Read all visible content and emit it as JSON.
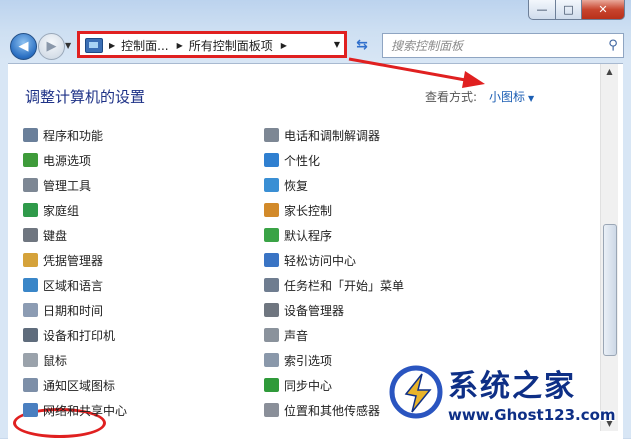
{
  "window": {
    "minimize_glyph": "—",
    "maximize_glyph": "□",
    "close_glyph": "✕"
  },
  "address": {
    "crumbs": [
      "控制面...",
      "所有控制面板项"
    ]
  },
  "search": {
    "placeholder": "搜索控制面板"
  },
  "header": {
    "title": "调整计算机的设置",
    "view_label": "查看方式:",
    "view_value": "小图标"
  },
  "items_left": [
    {
      "label": "程序和功能",
      "icon": "programs-icon",
      "color": "#6a7f9a"
    },
    {
      "label": "电源选项",
      "icon": "power-icon",
      "color": "#3e9b3a"
    },
    {
      "label": "管理工具",
      "icon": "admin-tools-icon",
      "color": "#7d8794"
    },
    {
      "label": "家庭组",
      "icon": "homegroup-icon",
      "color": "#2f9a4a"
    },
    {
      "label": "键盘",
      "icon": "keyboard-icon",
      "color": "#6f7680"
    },
    {
      "label": "凭据管理器",
      "icon": "credential-icon",
      "color": "#d5a23a"
    },
    {
      "label": "区域和语言",
      "icon": "region-icon",
      "color": "#3a86c8"
    },
    {
      "label": "日期和时间",
      "icon": "clock-icon",
      "color": "#8c9cb3"
    },
    {
      "label": "设备和打印机",
      "icon": "printer-icon",
      "color": "#5f6c7c"
    },
    {
      "label": "鼠标",
      "icon": "mouse-icon",
      "color": "#9aa2ab"
    },
    {
      "label": "通知区域图标",
      "icon": "notification-icon",
      "color": "#7d8fa8"
    },
    {
      "label": "网络和共享中心",
      "icon": "network-icon",
      "color": "#4a7fc0"
    }
  ],
  "items_right": [
    {
      "label": "电话和调制解调器",
      "icon": "phone-icon",
      "color": "#7d8794"
    },
    {
      "label": "个性化",
      "icon": "personalize-icon",
      "color": "#2f7fd0"
    },
    {
      "label": "恢复",
      "icon": "recovery-icon",
      "color": "#3a8fd4"
    },
    {
      "label": "家长控制",
      "icon": "parental-icon",
      "color": "#d28a2a"
    },
    {
      "label": "默认程序",
      "icon": "default-programs-icon",
      "color": "#3aa346"
    },
    {
      "label": "轻松访问中心",
      "icon": "accessibility-icon",
      "color": "#3a74c4"
    },
    {
      "label": "任务栏和「开始」菜单",
      "icon": "taskbar-icon",
      "color": "#6f7d90"
    },
    {
      "label": "设备管理器",
      "icon": "device-manager-icon",
      "color": "#6f7680"
    },
    {
      "label": "声音",
      "icon": "speaker-icon",
      "color": "#8a929c"
    },
    {
      "label": "索引选项",
      "icon": "index-icon",
      "color": "#8a98aa"
    },
    {
      "label": "同步中心",
      "icon": "sync-icon",
      "color": "#2f9a3a"
    },
    {
      "label": "位置和其他传感器",
      "icon": "sensor-icon",
      "color": "#8a8f99"
    }
  ],
  "watermark": {
    "title": "系统之家",
    "url": "www.Ghost123.com"
  }
}
